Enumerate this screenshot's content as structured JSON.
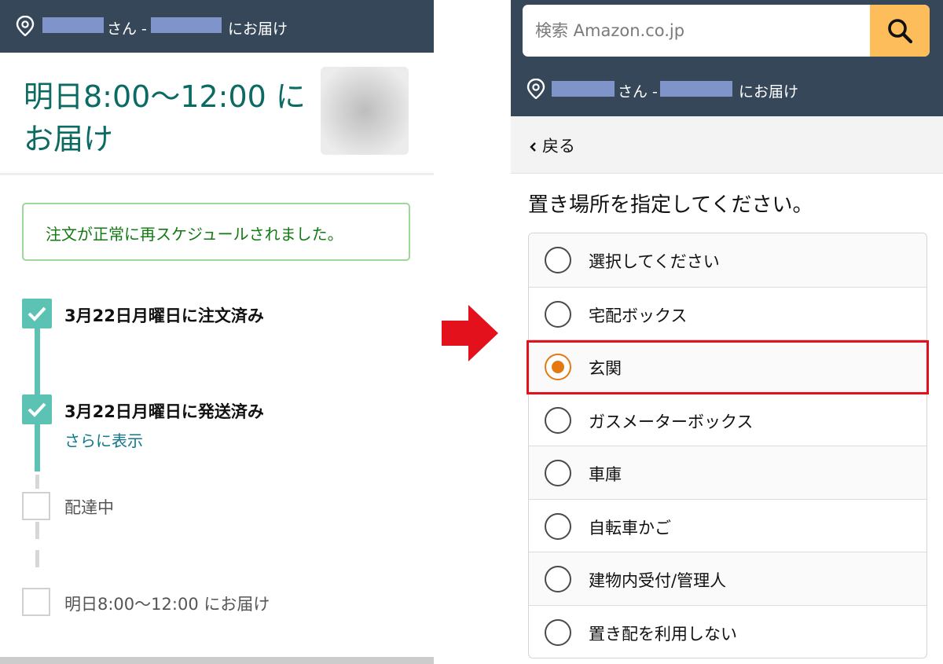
{
  "left": {
    "nav": {
      "suffix_san": "さん -",
      "suffix_deliver": "にお届け"
    },
    "heading": "明日8:00〜12:00 にお届け",
    "success_message": "注文が正常に再スケジュールされました。",
    "steps": [
      {
        "label": "3月22日月曜日に注文済み",
        "done": true
      },
      {
        "label": "3月22日月曜日に発送済み",
        "done": true,
        "link": "さらに表示"
      },
      {
        "label": "配達中",
        "done": false
      },
      {
        "label": "明日8:00〜12:00 にお届け",
        "done": false
      }
    ]
  },
  "right": {
    "search": {
      "placeholder": "検索 Amazon.co.jp"
    },
    "nav": {
      "suffix_san": "さん -",
      "suffix_deliver": "にお届け"
    },
    "back": "戻る",
    "prompt": "置き場所を指定してください。",
    "options": [
      {
        "label": "選択してください",
        "selected": false
      },
      {
        "label": "宅配ボックス",
        "selected": false
      },
      {
        "label": "玄関",
        "selected": true
      },
      {
        "label": "ガスメーターボックス",
        "selected": false
      },
      {
        "label": "車庫",
        "selected": false
      },
      {
        "label": "自転車かご",
        "selected": false
      },
      {
        "label": "建物内受付/管理人",
        "selected": false
      },
      {
        "label": "置き配を利用しない",
        "selected": false
      }
    ]
  },
  "colors": {
    "nav_bg": "#37475a",
    "heading_teal": "#0b6b63",
    "success_green": "#117a11",
    "timeline_teal": "#5cc3b4",
    "link_teal": "#0d7a8c",
    "search_button": "#fdbd5a",
    "radio_selected": "#e47911",
    "highlight_red": "#e3111b"
  },
  "icons": [
    "location-pin-icon",
    "check-icon",
    "arrow-right-icon",
    "search-icon",
    "chevron-left-icon"
  ]
}
